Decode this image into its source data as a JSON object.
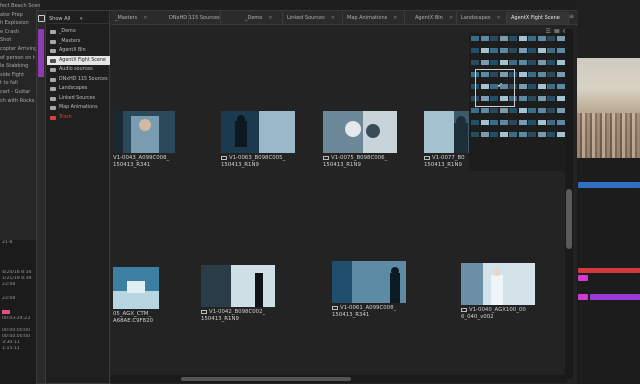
{
  "background_left": {
    "items": [
      "fect Beach Scene",
      "ator Prep",
      "h Explosion",
      "e Crash",
      "Shot",
      "copter Arriving",
      "of person on t",
      "le Stabbing",
      "side Fight",
      "t to fall",
      "cart - Guitar",
      "ch with Rocks"
    ],
    "timecodes": [
      "21-8",
      "4/24/16 8:34",
      "1/21/19 8:39",
      "23:08",
      "23:08",
      "00:03:24:23",
      "00:00:00:00",
      "00:00:00:00",
      "3:30:11",
      "1:15:11"
    ]
  },
  "sidebar": {
    "header": "Show All",
    "items": [
      {
        "label": "_Demo",
        "state": "normal"
      },
      {
        "label": "_Masters",
        "state": "normal"
      },
      {
        "label": "AgentX Bin",
        "state": "normal"
      },
      {
        "label": "AgentX Fight Scene",
        "state": "active"
      },
      {
        "label": "Audio sources",
        "state": "normal"
      },
      {
        "label": "DNxHD 115 Sources",
        "state": "normal"
      },
      {
        "label": "Landscapes",
        "state": "normal"
      },
      {
        "label": "Linked Sources",
        "state": "normal"
      },
      {
        "label": "Map Animations",
        "state": "normal"
      },
      {
        "label": "Trash",
        "state": "red"
      }
    ]
  },
  "tabs": [
    {
      "label": "_Masters",
      "active": false
    },
    {
      "label": "DNxHD 115 Sources",
      "active": false
    },
    {
      "label": "_Demo",
      "active": false
    },
    {
      "label": "Linked Sources",
      "active": false
    },
    {
      "label": "Map Animations",
      "active": false
    },
    {
      "label": "AgentX Bin",
      "active": false
    },
    {
      "label": "Landscapes",
      "active": false
    },
    {
      "label": "AgentX Fight Scene",
      "active": true
    }
  ],
  "clips": [
    {
      "label1": "V1-0043_A099C008_",
      "label2": "150413_R341",
      "colors": [
        "#2a4a5c",
        "#7a9cb0"
      ]
    },
    {
      "label1": "V1-0063_B098C005_",
      "label2": "150413_R1N9",
      "colors": [
        "#1c3a4e",
        "#9ab8c8"
      ]
    },
    {
      "label1": "V1-0075_B098C006_",
      "label2": "150413_R1N9",
      "colors": [
        "#6d8898",
        "#c8d4da"
      ]
    },
    {
      "label1": "V1-0077_B0",
      "label2": "150413_R1N9",
      "colors": [
        "#3b5a6e",
        "#a4c2d0"
      ]
    },
    {
      "label1": "05_AGX_CTM_",
      "label2": "A68AE.C9F820",
      "colors": [
        "#3c7fa3",
        "#b8d6e2"
      ]
    },
    {
      "label1": "V1-0042_B098C002_",
      "label2": "150413_R1N9",
      "colors": [
        "#2a3c48",
        "#cfdfe6"
      ]
    },
    {
      "label1": "V1-0061_A099C008_",
      "label2": "150413_R341",
      "colors": [
        "#1f4f6a",
        "#5d8aa4"
      ]
    },
    {
      "label1": "V1-0040_AGX100_00",
      "label2": "6_040_v002",
      "colors": [
        "#6a8fa6",
        "#d4e2ea"
      ]
    }
  ],
  "toolbar_icons": [
    "list-view-icon",
    "grid-view-icon",
    "settings-icon"
  ],
  "accent": "#8e3bb0"
}
